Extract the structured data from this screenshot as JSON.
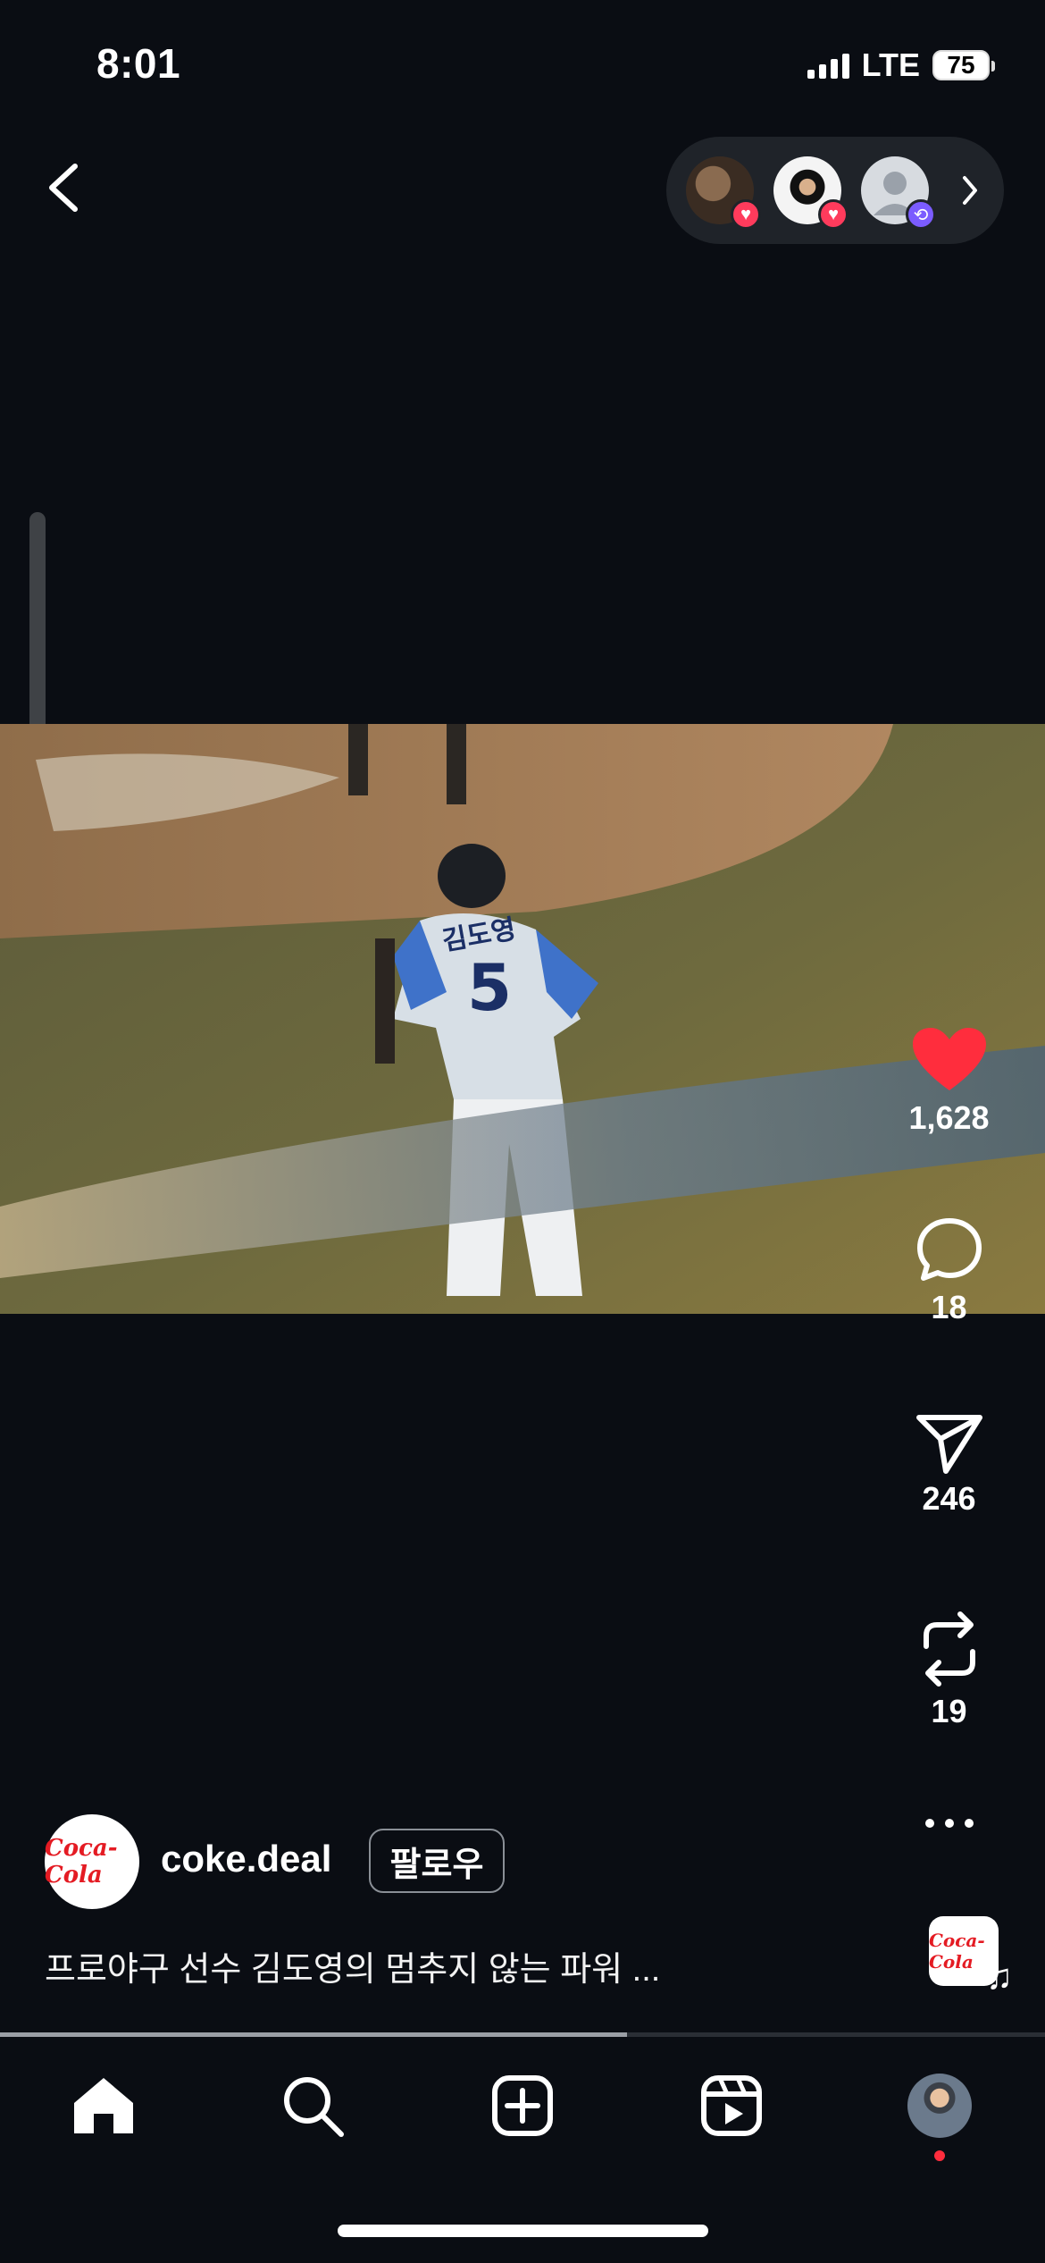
{
  "status_bar": {
    "time": "8:01",
    "network": "LTE",
    "battery": "75"
  },
  "stack": {
    "avatars": [
      {
        "icon": "heart-badge-icon",
        "badge_color": "#ff3b5c"
      },
      {
        "icon": "heart-badge-icon",
        "badge_color": "#ff3b5c"
      },
      {
        "icon": "repost-badge-icon",
        "badge_color": "#7b5cff"
      }
    ]
  },
  "actions": {
    "likes": "1,628",
    "comments": "18",
    "shares": "246",
    "reposts": "19",
    "like_color": "#ff2d3d"
  },
  "post": {
    "username": "coke.deal",
    "follow_label": "팔로우",
    "avatar_logo": "Coca-Cola",
    "caption": "프로야구 선수 김도영의 멈추지 않는 파워 ...",
    "music_logo": "Coca-Cola"
  },
  "video": {
    "jersey_name": "김도영",
    "jersey_number": "5",
    "progress": 0.6
  },
  "tabs": [
    {
      "name": "home",
      "icon": "home-icon"
    },
    {
      "name": "search",
      "icon": "search-icon"
    },
    {
      "name": "create",
      "icon": "plus-square-icon"
    },
    {
      "name": "reels",
      "icon": "reels-icon"
    },
    {
      "name": "profile",
      "icon": "avatar"
    }
  ]
}
